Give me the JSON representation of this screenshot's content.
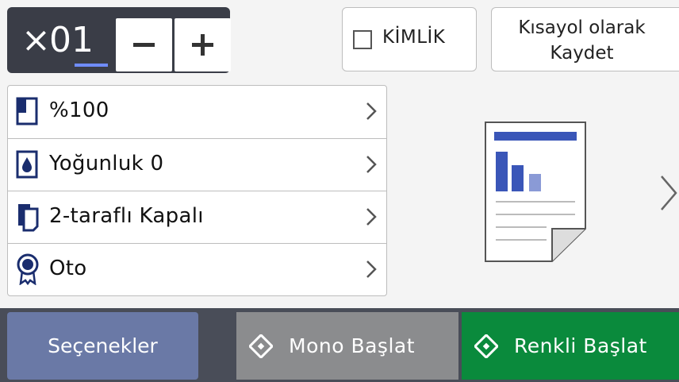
{
  "copies": {
    "prefix": "×",
    "value": "01"
  },
  "id_copy": {
    "label": "KİMLİK",
    "checked": false
  },
  "shortcut": {
    "line1": "Kısayol olarak",
    "line2": "Kaydet"
  },
  "settings": [
    {
      "icon": "page-size-icon",
      "label": "%100"
    },
    {
      "icon": "density-drop-icon",
      "label": "Yoğunluk 0"
    },
    {
      "icon": "duplex-icon",
      "label": "2-taraflı Kapalı"
    },
    {
      "icon": "quality-ribbon-icon",
      "label": "Oto"
    }
  ],
  "bottom": {
    "options_label": "Seçenekler",
    "mono_label": "Mono Başlat",
    "color_label": "Renkli Başlat"
  },
  "colors": {
    "copies_bg": "#3a3d47",
    "options_bg": "#6a79a6",
    "mono_bg": "#8b8c8e",
    "color_bg": "#0a8a3c",
    "accent_blue": "#3a56b8"
  }
}
